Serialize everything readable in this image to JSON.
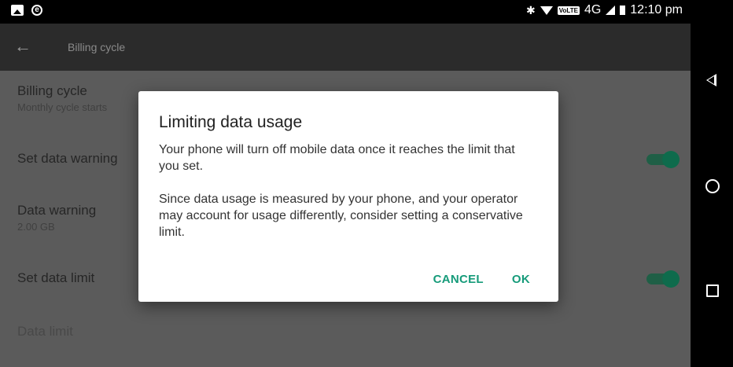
{
  "status_bar": {
    "time": "12:10 pm",
    "network": "4G",
    "volte": "VoLTE",
    "icons": [
      "image-icon",
      "e-icon",
      "bluetooth-icon",
      "wifi-icon",
      "signal-icon",
      "battery-icon"
    ]
  },
  "toolbar": {
    "title": "Billing cycle"
  },
  "settings": {
    "billing_cycle": {
      "title": "Billing cycle",
      "subtitle": "Monthly cycle starts"
    },
    "set_data_warning": {
      "title": "Set data warning"
    },
    "data_warning": {
      "title": "Data warning",
      "subtitle": "2.00 GB"
    },
    "set_data_limit": {
      "title": "Set data limit"
    },
    "data_limit": {
      "title": "Data limit"
    }
  },
  "dialog": {
    "title": "Limiting data usage",
    "paragraph1": "Your phone will turn off mobile data once it reaches the limit that you set.",
    "paragraph2": "Since data usage is measured by your phone, and your operator may account for usage differently, consider setting a conservative limit.",
    "cancel_label": "CANCEL",
    "ok_label": "OK"
  },
  "colors": {
    "accent": "#169b7a",
    "toggle_on": "#0e6b4c"
  }
}
